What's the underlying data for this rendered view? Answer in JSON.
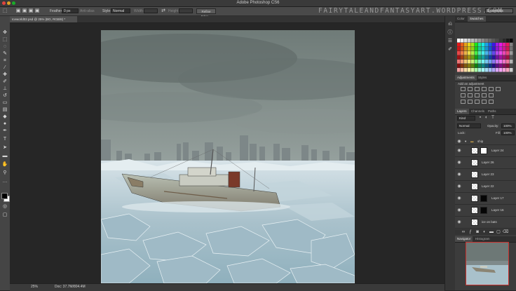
{
  "window": {
    "title": "Adobe Photoshop CS6",
    "watermark": "FAIRYTALEANDFANTASYART.WORDPRESS.COM"
  },
  "options_bar": {
    "feather_label": "Feather:",
    "feather_value": "0 px",
    "antialias_label": "Anti-alias",
    "style_label": "Style:",
    "style_value": "Normal",
    "width_label": "Width:",
    "height_label": "Height:",
    "refine_edge": "Refine Edge...",
    "workspace": "Essentials"
  },
  "document": {
    "tab_label": "Iceworld02.psd @ 25% (BG, RGB/8) *",
    "zoom": "25%",
    "doc_size": "Doc: 37.7M/804.4M"
  },
  "panels": {
    "swatches_tabs": [
      "Color",
      "Swatches"
    ],
    "adjust_tabs": [
      "Adjustments",
      "Styles"
    ],
    "adjust_heading": "Add an adjustment",
    "layers_tabs": [
      "Layers",
      "Channels",
      "Paths"
    ],
    "kind_label": "Kind",
    "blend_mode": "Normal",
    "opacity_label": "Opacity:",
    "opacity_value": "100%",
    "lock_label": "Lock:",
    "fill_label": "Fill:",
    "fill_value": "100%",
    "group_name": "ship",
    "layers": [
      {
        "name": "Layer 24",
        "thumb": "white-mask"
      },
      {
        "name": "Layer 26",
        "thumb": "transparent"
      },
      {
        "name": "Layer 23",
        "thumb": "transparent"
      },
      {
        "name": "Layer 22",
        "thumb": "transparent"
      },
      {
        "name": "Layer 17",
        "thumb": "black-mask"
      },
      {
        "name": "Layer 16",
        "thumb": "black-mask"
      },
      {
        "name": "ice on bats",
        "thumb": "transparent"
      }
    ],
    "navigator_tabs": [
      "Navigator",
      "Histogram"
    ]
  },
  "colors": {
    "accent_red": "#c8312e",
    "panel_bg": "#3c3c3c",
    "canvas_bg": "#262626"
  }
}
